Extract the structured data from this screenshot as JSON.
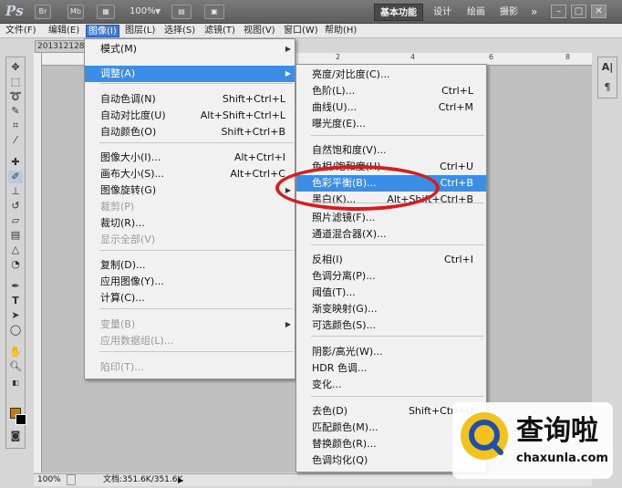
{
  "titlebar": {
    "logo": "Ps",
    "br_label": "Br",
    "mb_label": "Mb",
    "zoom": "100%",
    "workspaces": [
      "基本功能",
      "设计",
      "绘画",
      "摄影"
    ],
    "extend_symbol": "»"
  },
  "menubar": {
    "items": [
      "文件(F)",
      "编辑(E)",
      "图像(I)",
      "图层(L)",
      "选择(S)",
      "滤镜(T)",
      "视图(V)",
      "窗口(W)",
      "帮助(H)"
    ]
  },
  "document": {
    "tab": "2013121284",
    "ruler_ticks": [
      "2",
      "4",
      "6",
      "8"
    ]
  },
  "status": {
    "zoom": "100%",
    "doc_info": "文档:351.6K/351.6K"
  },
  "image_menu": {
    "items": [
      {
        "label": "模式(M)",
        "shortcut": "",
        "submenu": true,
        "disabled": false
      },
      {
        "label": "调整(A)",
        "shortcut": "",
        "submenu": true,
        "disabled": false,
        "highlighted": true
      },
      {
        "label": "自动色调(N)",
        "shortcut": "Shift+Ctrl+L",
        "disabled": false
      },
      {
        "label": "自动对比度(U)",
        "shortcut": "Alt+Shift+Ctrl+L",
        "disabled": false
      },
      {
        "label": "自动颜色(O)",
        "shortcut": "Shift+Ctrl+B",
        "disabled": false
      },
      {
        "label": "图像大小(I)...",
        "shortcut": "Alt+Ctrl+I",
        "disabled": false
      },
      {
        "label": "画布大小(S)...",
        "shortcut": "Alt+Ctrl+C",
        "disabled": false
      },
      {
        "label": "图像旋转(G)",
        "shortcut": "",
        "submenu": true,
        "disabled": false
      },
      {
        "label": "裁剪(P)",
        "shortcut": "",
        "disabled": true
      },
      {
        "label": "裁切(R)...",
        "shortcut": "",
        "disabled": false
      },
      {
        "label": "显示全部(V)",
        "shortcut": "",
        "disabled": true
      },
      {
        "label": "复制(D)...",
        "shortcut": "",
        "disabled": false
      },
      {
        "label": "应用图像(Y)...",
        "shortcut": "",
        "disabled": false
      },
      {
        "label": "计算(C)...",
        "shortcut": "",
        "disabled": false
      },
      {
        "label": "变量(B)",
        "shortcut": "",
        "submenu": true,
        "disabled": true
      },
      {
        "label": "应用数据组(L)...",
        "shortcut": "",
        "disabled": true
      },
      {
        "label": "陷印(T)...",
        "shortcut": "",
        "disabled": true
      }
    ]
  },
  "adjust_menu": {
    "items": [
      {
        "label": "亮度/对比度(C)...",
        "shortcut": ""
      },
      {
        "label": "色阶(L)...",
        "shortcut": "Ctrl+L"
      },
      {
        "label": "曲线(U)...",
        "shortcut": "Ctrl+M"
      },
      {
        "label": "曝光度(E)...",
        "shortcut": ""
      },
      {
        "label": "自然饱和度(V)...",
        "shortcut": ""
      },
      {
        "label": "色相/饱和度(H)...",
        "shortcut": "Ctrl+U"
      },
      {
        "label": "色彩平衡(B)...",
        "shortcut": "Ctrl+B",
        "highlighted": true
      },
      {
        "label": "黑白(K)...",
        "shortcut": "Alt+Shift+Ctrl+B"
      },
      {
        "label": "照片滤镜(F)...",
        "shortcut": ""
      },
      {
        "label": "通道混合器(X)...",
        "shortcut": ""
      },
      {
        "label": "反相(I)",
        "shortcut": "Ctrl+I"
      },
      {
        "label": "色调分离(P)...",
        "shortcut": ""
      },
      {
        "label": "阈值(T)...",
        "shortcut": ""
      },
      {
        "label": "渐变映射(G)...",
        "shortcut": ""
      },
      {
        "label": "可选颜色(S)...",
        "shortcut": ""
      },
      {
        "label": "阴影/高光(W)...",
        "shortcut": ""
      },
      {
        "label": "HDR 色调...",
        "shortcut": ""
      },
      {
        "label": "变化...",
        "shortcut": ""
      },
      {
        "label": "去色(D)",
        "shortcut": "Shift+Ctrl+U"
      },
      {
        "label": "匹配颜色(M)...",
        "shortcut": ""
      },
      {
        "label": "替换颜色(R)...",
        "shortcut": ""
      },
      {
        "label": "色调均化(Q)",
        "shortcut": ""
      }
    ]
  },
  "watermark": {
    "brand": "查询啦",
    "url": "chaxunla.com"
  },
  "colors": {
    "highlight": "#3a8ee6",
    "annotation": "#d81c1c",
    "foreground": "#c07b1a",
    "background": "#000000"
  },
  "icons": {
    "right_panel": [
      "character-panel-icon",
      "paragraph-panel-icon"
    ]
  }
}
